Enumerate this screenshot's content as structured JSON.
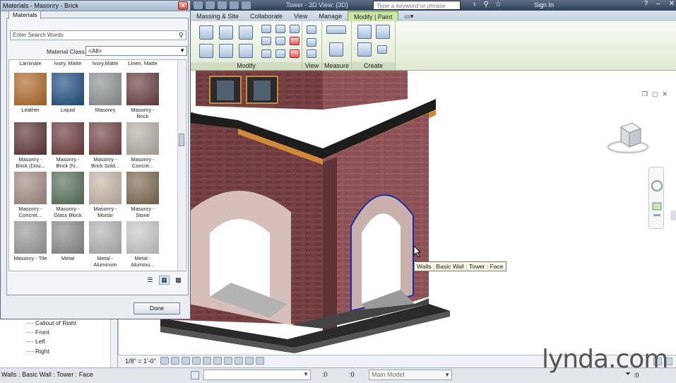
{
  "window": {
    "doc_title": "Tower - 3D View: {3D}",
    "search_placeholder": "Type a keyword or phrase",
    "sign_in": "Sign In"
  },
  "ribbon": {
    "tabs": [
      "Massing & Site",
      "Collaborate",
      "View",
      "Manage",
      "Modify | Paint"
    ],
    "active_tab": "Modify | Paint",
    "panels": [
      "Modify",
      "View",
      "Measure",
      "Create"
    ]
  },
  "materials_dialog": {
    "title": "Materials - Masonry - Brick",
    "tab": "Materials",
    "search_placeholder": "Enter Search Words",
    "class_label": "Material Class:",
    "class_value": "<All>",
    "top_row": [
      "Laminate",
      "Laminate - Ivory, Matte",
      "Laminate - Ivory,Matte",
      "Laminate - Linen, Matte"
    ],
    "materials": [
      {
        "label": "Leather",
        "color": "#b06a2a"
      },
      {
        "label": "Liquid",
        "color": "#1f4f80"
      },
      {
        "label": "Masonry",
        "color": "#8f9496"
      },
      {
        "label": "Masonry - Brick",
        "color": "#6a3e42"
      },
      {
        "label": "Masonry - Brick (Dou...",
        "color": "#5e3438"
      },
      {
        "label": "Masonry - Brick (N...",
        "color": "#6b3a3c"
      },
      {
        "label": "Masonry - Brick Sold...",
        "color": "#744446"
      },
      {
        "label": "Masonry - Concre...",
        "color": "#b5b0a8"
      },
      {
        "label": "Masonry - Concret...",
        "color": "#a58c84"
      },
      {
        "label": "Masonry - Glass Block",
        "color": "#58705a"
      },
      {
        "label": "Masonry - Mortar",
        "color": "#c8b7a9"
      },
      {
        "label": "Masonry - Stone",
        "color": "#7e6a50"
      },
      {
        "label": "Masonry - Tile",
        "color": "#9c9c9c"
      },
      {
        "label": "Metal",
        "color": "#8c8c8c"
      },
      {
        "label": "Metal - Aluminum",
        "color": "#b4b4b4"
      },
      {
        "label": "Metal - Aluminu...",
        "color": "#cacaca"
      }
    ],
    "done_label": "Done"
  },
  "project_browser": {
    "items": [
      "Callout of Right",
      "Front",
      "Left",
      "Right"
    ]
  },
  "viewport": {
    "tooltip": "Walls : Basic Wall : Tower : Face"
  },
  "view_control": {
    "scale": "1/8\" = 1'-0\""
  },
  "status_bar": {
    "text": "Walls : Basic Wall : Tower : Face",
    "edit_requests": ":0",
    "model": "Main Model",
    "selection_count": ":0"
  },
  "watermark": "lynda.com"
}
